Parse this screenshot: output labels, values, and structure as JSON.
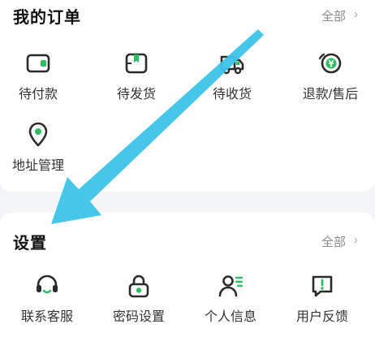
{
  "colors": {
    "accent": "#2dbe60",
    "icon_stroke": "#2b2b2b",
    "annotation_arrow": "#3cc4e8",
    "page_bg": "#f4f5f7"
  },
  "orders": {
    "title": "我的订单",
    "more_label": "全部",
    "more_arrow": "›",
    "items": [
      {
        "label": "待付款",
        "icon": "wallet-icon"
      },
      {
        "label": "待发货",
        "icon": "package-icon"
      },
      {
        "label": "待收货",
        "icon": "truck-icon"
      },
      {
        "label": "退款/售后",
        "icon": "refund-icon"
      },
      {
        "label": "地址管理",
        "icon": "location-pin-icon"
      }
    ]
  },
  "settings": {
    "title": "设置",
    "more_label": "全部",
    "more_arrow": "›",
    "items": [
      {
        "label": "联系客服",
        "icon": "headset-icon"
      },
      {
        "label": "密码设置",
        "icon": "lock-icon"
      },
      {
        "label": "个人信息",
        "icon": "user-profile-icon"
      },
      {
        "label": "用户反馈",
        "icon": "feedback-icon"
      }
    ]
  }
}
